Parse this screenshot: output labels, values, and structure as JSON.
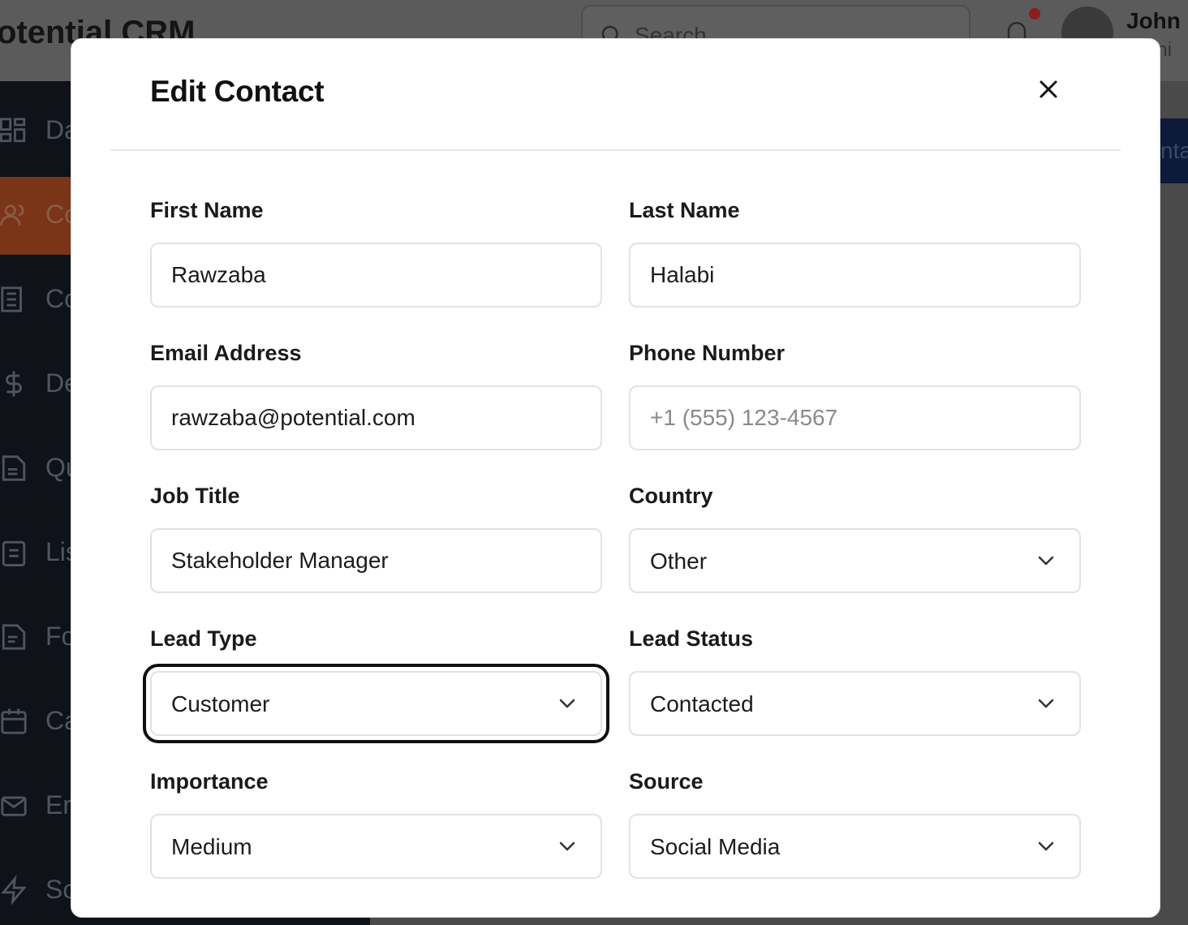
{
  "background": {
    "brand": "otential CRM",
    "search_placeholder": "Search",
    "user_name": "John I",
    "user_role": "mini",
    "nav": [
      {
        "label": "Da",
        "icon": "dashboard-icon"
      },
      {
        "label": "Co",
        "icon": "users-icon"
      },
      {
        "label": "Co",
        "icon": "building-icon"
      },
      {
        "label": "De",
        "icon": "dollar-icon"
      },
      {
        "label": "Qu",
        "icon": "file-text-icon"
      },
      {
        "label": "Lis",
        "icon": "clipboard-list-icon"
      },
      {
        "label": "Fo",
        "icon": "file-icon"
      },
      {
        "label": "Ca",
        "icon": "calendar-icon"
      },
      {
        "label": "Er",
        "icon": "mail-icon"
      },
      {
        "label": "Sc",
        "icon": "zap-icon"
      }
    ],
    "new_button": "nta"
  },
  "modal": {
    "title": "Edit Contact",
    "fields": {
      "first_name": {
        "label": "First Name",
        "value": "Rawzaba"
      },
      "last_name": {
        "label": "Last Name",
        "value": "Halabi"
      },
      "email": {
        "label": "Email Address",
        "value": "rawzaba@potential.com"
      },
      "phone": {
        "label": "Phone Number",
        "value": "",
        "placeholder": "+1 (555) 123-4567"
      },
      "job_title": {
        "label": "Job Title",
        "value": "Stakeholder Manager"
      },
      "country": {
        "label": "Country",
        "value": "Other"
      },
      "lead_type": {
        "label": "Lead Type",
        "value": "Customer"
      },
      "lead_status": {
        "label": "Lead Status",
        "value": "Contacted"
      },
      "importance": {
        "label": "Importance",
        "value": "Medium"
      },
      "source": {
        "label": "Source",
        "value": "Social Media"
      }
    }
  }
}
